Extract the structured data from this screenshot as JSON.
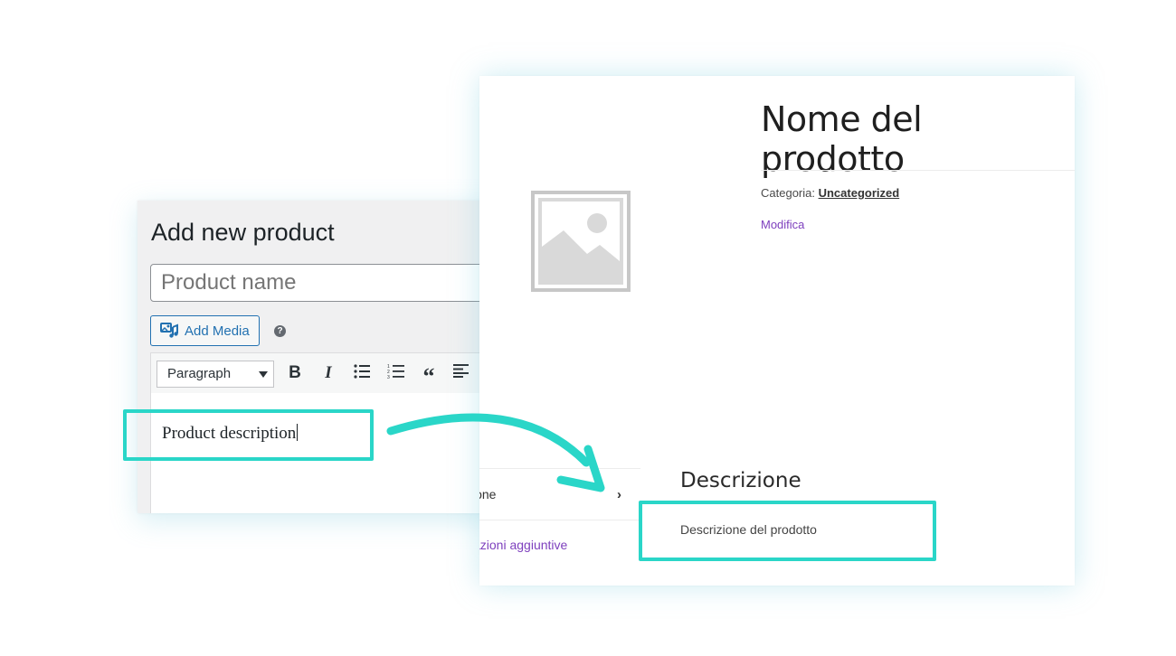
{
  "admin": {
    "title": "Add new product",
    "product_name_placeholder": "Product name",
    "add_media_label": "Add Media",
    "help_glyph": "?",
    "format_select_value": "Paragraph",
    "toolbar_icons": [
      "bold-icon",
      "italic-icon",
      "bulleted-list-icon",
      "numbered-list-icon",
      "blockquote-icon",
      "align-left-icon"
    ],
    "editor_text": "Product description"
  },
  "shop": {
    "product_title": "Nome del prodotto",
    "category_label": "Categoria: ",
    "category_link": "Uncategorized",
    "edit_link": "Modifica",
    "tab_description": "ione",
    "tab_additional_info": "azioni aggiuntive",
    "description_heading": "Descrizione",
    "description_body": "Descrizione del prodotto"
  },
  "colors": {
    "highlight": "#2ad6c8",
    "wp_blue": "#2271b1",
    "link_purple": "#7d3fbd"
  }
}
